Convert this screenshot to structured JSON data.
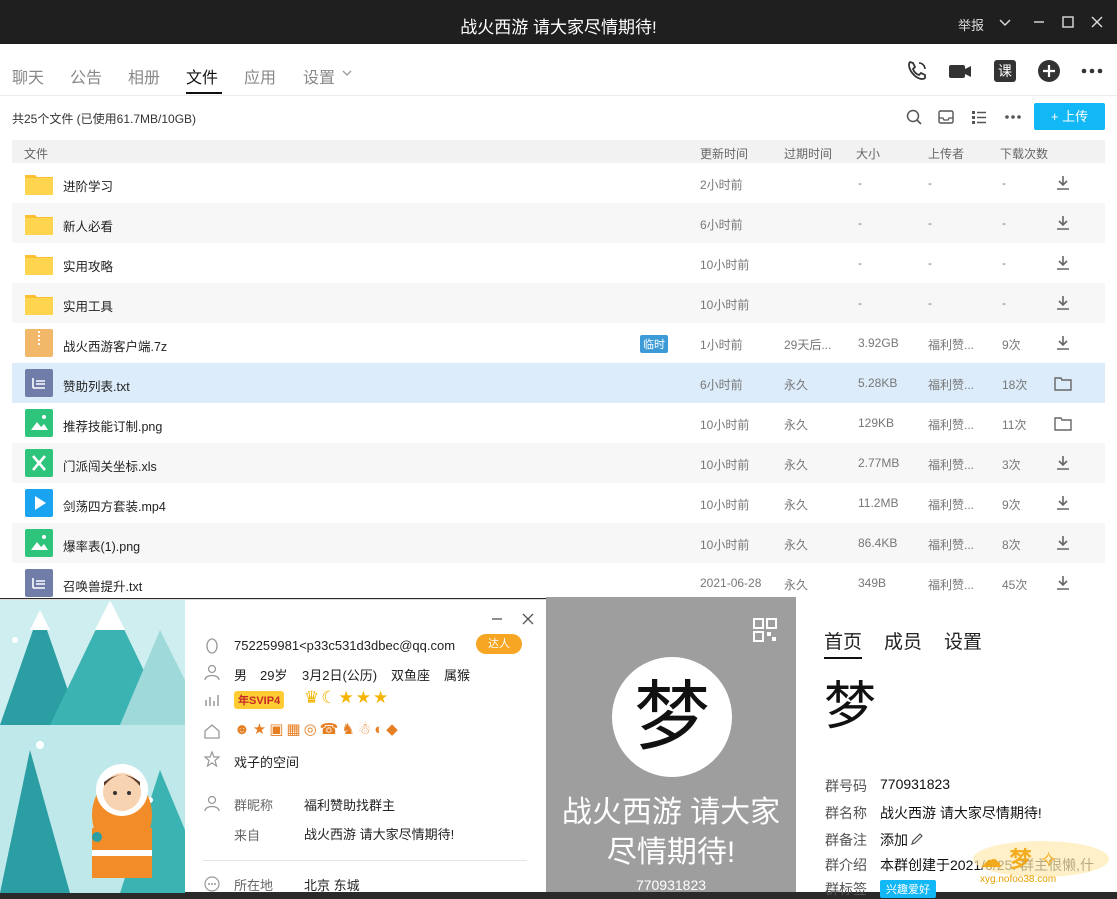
{
  "window": {
    "title": "战火西游 请大家尽情期待!",
    "report_label": "举报"
  },
  "tabs": [
    {
      "label": "聊天"
    },
    {
      "label": "公告"
    },
    {
      "label": "相册"
    },
    {
      "label": "文件"
    },
    {
      "label": "应用"
    },
    {
      "label": "设置"
    }
  ],
  "toolbar": {
    "summary": "共25个文件 (已使用61.7MB/10GB)",
    "upload_label": "上传"
  },
  "table": {
    "headers": [
      "文件",
      "更新时间",
      "过期时间",
      "大小",
      "上传者",
      "下载次数"
    ],
    "temp_badge": "临时",
    "rows": [
      {
        "name": "进阶学习",
        "type": "folder",
        "updated": "2小时前",
        "expires": "",
        "size": "-",
        "uploader": "-",
        "downloads": "-",
        "action": "download-icon"
      },
      {
        "name": "新人必看",
        "type": "folder",
        "updated": "6小时前",
        "expires": "",
        "size": "-",
        "uploader": "-",
        "downloads": "-",
        "action": "download-icon"
      },
      {
        "name": "实用攻略",
        "type": "folder",
        "updated": "10小时前",
        "expires": "",
        "size": "-",
        "uploader": "-",
        "downloads": "-",
        "action": "download-icon"
      },
      {
        "name": "实用工具",
        "type": "folder",
        "updated": "10小时前",
        "expires": "",
        "size": "-",
        "uploader": "-",
        "downloads": "-",
        "action": "download-icon"
      },
      {
        "name": "战火西游客户端.7z",
        "type": "zip",
        "updated": "1小时前",
        "expires": "29天后...",
        "size": "3.92GB",
        "uploader": "福利赞...",
        "downloads": "9次",
        "action": "download-icon",
        "temp": true
      },
      {
        "name": "赞助列表.txt",
        "type": "txt",
        "updated": "6小时前",
        "expires": "永久",
        "size": "5.28KB",
        "uploader": "福利赞...",
        "downloads": "18次",
        "action": "folder-open-icon"
      },
      {
        "name": "推荐技能订制.png",
        "type": "image",
        "updated": "10小时前",
        "expires": "永久",
        "size": "129KB",
        "uploader": "福利赞...",
        "downloads": "11次",
        "action": "folder-open-icon"
      },
      {
        "name": "门派闯关坐标.xls",
        "type": "excel",
        "updated": "10小时前",
        "expires": "永久",
        "size": "2.77MB",
        "uploader": "福利赞...",
        "downloads": "3次",
        "action": "download-icon"
      },
      {
        "name": "剑荡四方套装.mp4",
        "type": "video",
        "updated": "10小时前",
        "expires": "永久",
        "size": "11.2MB",
        "uploader": "福利赞...",
        "downloads": "9次",
        "action": "download-icon"
      },
      {
        "name": "爆率表(1).png",
        "type": "image",
        "updated": "10小时前",
        "expires": "永久",
        "size": "86.4KB",
        "uploader": "福利赞...",
        "downloads": "8次",
        "action": "download-icon"
      },
      {
        "name": "召唤兽提升.txt",
        "type": "txt",
        "updated": "2021-06-28",
        "expires": "永久",
        "size": "349B",
        "uploader": "福利赞...",
        "downloads": "45次",
        "action": "download-icon"
      }
    ]
  },
  "profile": {
    "qq": "752259981<p33c531d3dbec@qq.com",
    "badge_daren": "达人",
    "gender": "男",
    "age": "29岁",
    "birthday": "3月2日(公历)",
    "constellation": "双鱼座",
    "zodiac": "属猴",
    "vip": "年SVIP4",
    "space": "戏子的空间",
    "nick_label": "群昵称",
    "nick_value": "福利赞助找群主",
    "from_label": "来自",
    "from_value": "战火西游 请大家尽情期待!",
    "location_label": "所在地",
    "location_value": "北京 东城"
  },
  "group": {
    "avatar_char": "梦",
    "name_display": "战火西游 请大家尽情期待!",
    "number_display": "770931823",
    "tabs": [
      "首页",
      "成员",
      "设置"
    ],
    "number_label": "群号码",
    "number_value": "770931823",
    "name_label": "群名称",
    "name_value": "战火西游 请大家尽情期待!",
    "remark_label": "群备注",
    "remark_value": "添加",
    "intro_label": "群介绍",
    "intro_value": "本群创建于2021/6/25: 群主很懒,什",
    "tag_label": "群标签",
    "tag_value": "兴趣爱好"
  },
  "watermark": {
    "text": "xyg.nofoo38.com"
  },
  "colors": {
    "accent": "#12b7f5",
    "titlebar": "#1f1f1f",
    "selected_row": "#dcecfb",
    "folder": "#fbc02d"
  }
}
